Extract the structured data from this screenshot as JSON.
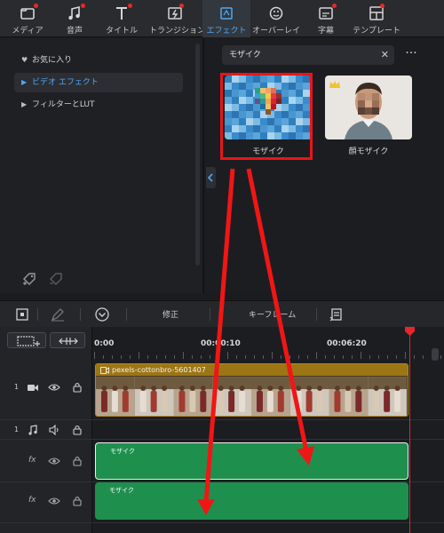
{
  "tabs": [
    {
      "label": "メディア",
      "icon": "media-folder-icon",
      "dot": true
    },
    {
      "label": "音声",
      "icon": "music-note-icon",
      "dot": true
    },
    {
      "label": "タイトル",
      "icon": "text-t-icon",
      "dot": true
    },
    {
      "label": "トランジション",
      "icon": "transition-icon",
      "dot": true
    },
    {
      "label": "エフェクト",
      "icon": "effects-icon",
      "dot": false,
      "active": true
    },
    {
      "label": "オーバーレイ",
      "icon": "overlay-icon",
      "dot": false
    },
    {
      "label": "字幕",
      "icon": "subtitle-icon",
      "dot": true
    },
    {
      "label": "テンプレート",
      "icon": "template-icon",
      "dot": true
    }
  ],
  "categories": [
    {
      "label": "お気に入り",
      "icon": "heart-icon"
    },
    {
      "label": "ビデオ エフェクト",
      "icon": "chevron-right-icon",
      "selected": true
    },
    {
      "label": "フィルターとLUT",
      "icon": "chevron-right-icon"
    }
  ],
  "search": {
    "value": "モザイク"
  },
  "effects": [
    {
      "name": "モザイク",
      "thumbnail": "pixelated-balloon",
      "selected": true
    },
    {
      "name": "顔モザイク",
      "thumbnail": "pixelated-face-portrait",
      "premium": true
    }
  ],
  "toolbar": {
    "edit_label": "修正",
    "keyframe_label": "キーフレーム"
  },
  "timeline": {
    "timecodes": [
      "0:00",
      "00:00:10",
      "00:06:20"
    ],
    "tracks": [
      {
        "number": "1",
        "type": "video",
        "icon": "camera-icon"
      },
      {
        "number": "1",
        "type": "audio",
        "icon": "music-note-icon"
      },
      {
        "number": "",
        "type": "fx",
        "label": "fx"
      },
      {
        "number": "",
        "type": "fx",
        "label": "fx"
      }
    ],
    "video_clip": {
      "name": "pexels-cottonbro-5601407"
    },
    "fx_clips": [
      {
        "name": "モザイク",
        "selected": true
      },
      {
        "name": "モザイク",
        "selected": false
      }
    ]
  },
  "colors": {
    "accent": "#4fa7f5",
    "highlight_red": "#e8151a",
    "fx_clip": "#1f8f4e",
    "video_clip_title": "#9c7514",
    "playhead": "#e6262a"
  }
}
